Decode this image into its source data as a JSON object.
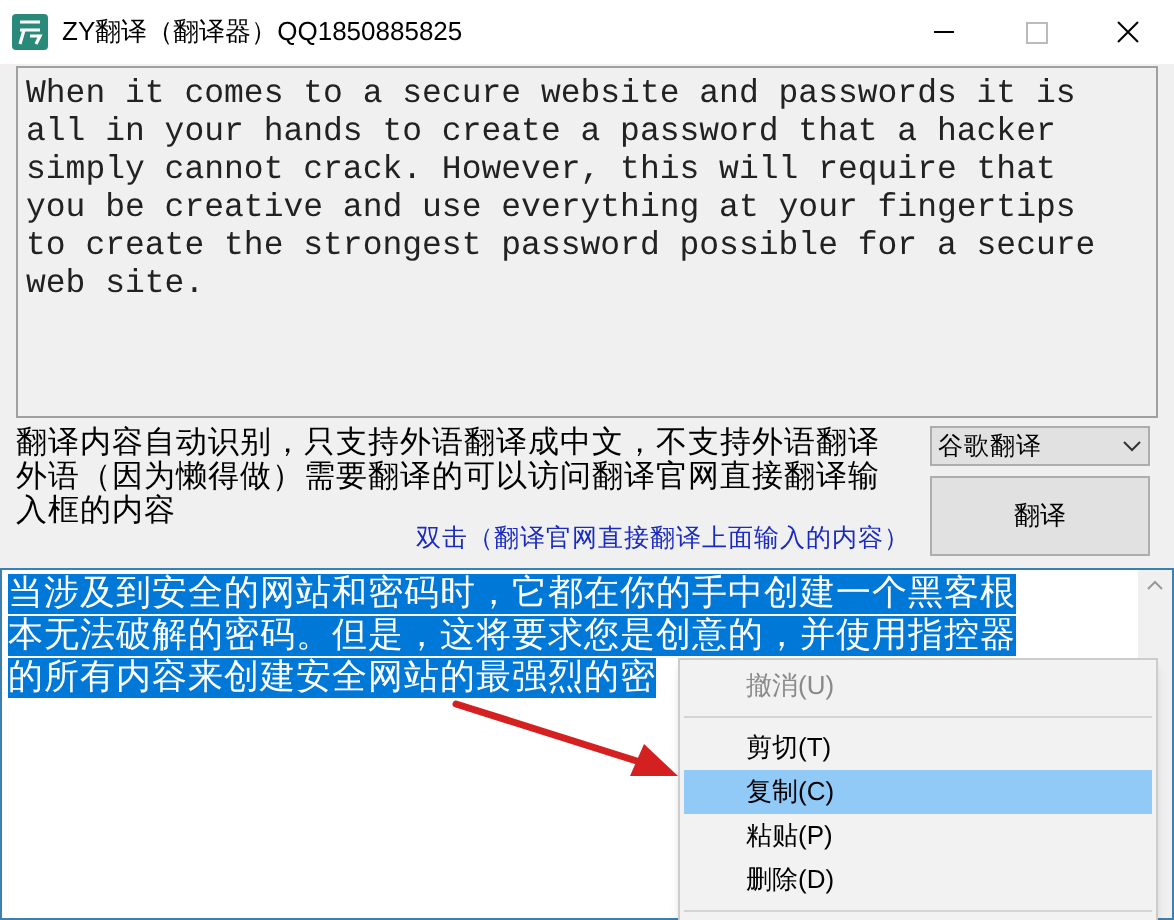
{
  "window": {
    "title": "ZY翻译（翻译器）QQ1850885825"
  },
  "source_text": {
    "lines": [
      "When it comes to a secure website and passwords it is",
      "all in your hands to create a password that a hacker",
      "simply cannot crack. However, this will require that",
      "you be creative and use everything at your fingertips",
      "to create the strongest password possible for a secure",
      "web site."
    ]
  },
  "notice": {
    "lines": [
      "翻译内容自动识别，只支持外语翻译成中文，不支持外语翻译",
      "外语（因为懒得做）需要翻译的可以访问翻译官网直接翻译输",
      "入框的内容"
    ]
  },
  "engine_select": {
    "value": "谷歌翻译"
  },
  "translate_button": {
    "label": "翻译"
  },
  "official_link": {
    "label": "双击（翻译官网直接翻译上面输入的内容）"
  },
  "result_text": {
    "selected": true,
    "lines": [
      "当涉及到安全的网站和密码时，它都在你的手中创建一个黑客根",
      "本无法破解的密码。但是，这将要求您是创意的，并使用指控器",
      "的所有内容来创建安全网站的最强烈的密"
    ]
  },
  "context_menu": {
    "items": [
      {
        "kind": "item",
        "label": "撤消(U)",
        "disabled": true,
        "selected": false
      },
      {
        "kind": "separator"
      },
      {
        "kind": "item",
        "label": "剪切(T)",
        "disabled": false,
        "selected": false
      },
      {
        "kind": "item",
        "label": "复制(C)",
        "disabled": false,
        "selected": true
      },
      {
        "kind": "item",
        "label": "粘贴(P)",
        "disabled": false,
        "selected": false
      },
      {
        "kind": "item",
        "label": "删除(D)",
        "disabled": false,
        "selected": false
      },
      {
        "kind": "separator"
      }
    ]
  }
}
